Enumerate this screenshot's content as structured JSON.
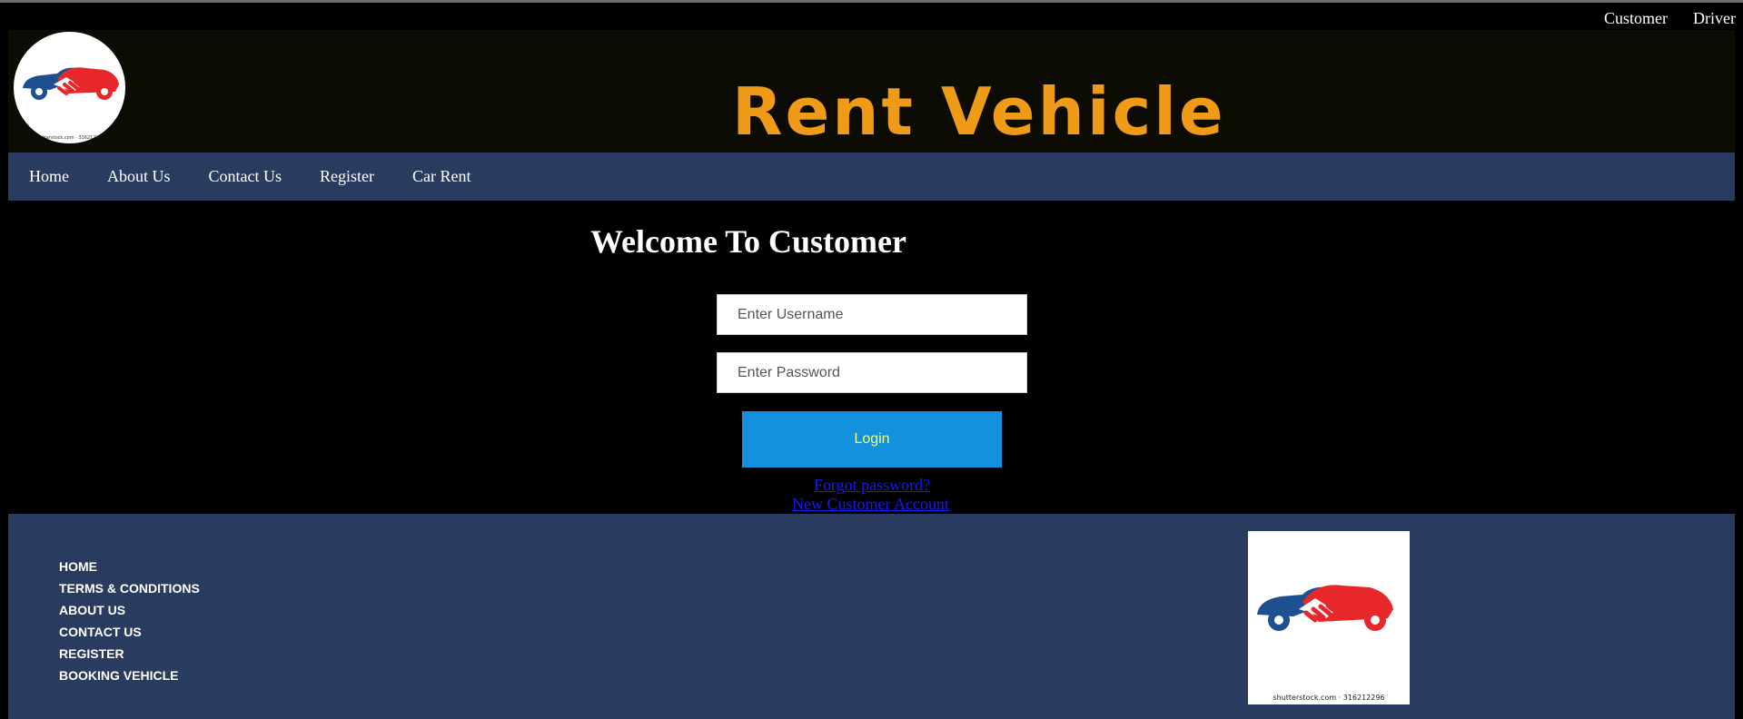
{
  "top_links": [
    "Customer",
    "Driver"
  ],
  "brand": {
    "title": "Rent Vehicle",
    "logo_caption": "shutterstock.com · 316212296",
    "title_color": "#ef9b17"
  },
  "nav": [
    "Home",
    "About Us",
    "Contact Us",
    "Register",
    "Car Rent"
  ],
  "login": {
    "heading": "Welcome To Customer",
    "username_placeholder": "Enter Username",
    "password_placeholder": "Enter Password",
    "button_label": "Login",
    "forgot_link": "Forgot password?",
    "new_account_link": "New Customer Account"
  },
  "footer": {
    "links": [
      "HOME",
      "TERMS & CONDITIONS",
      "ABOUT US",
      "CONTACT US",
      "REGISTER",
      "BOOKING VEHICLE"
    ],
    "logo_caption": "shutterstock.com · 316212296"
  },
  "colors": {
    "nav_bg": "#293c60",
    "button_bg": "#1391dd",
    "link": "#1a1ae8"
  }
}
